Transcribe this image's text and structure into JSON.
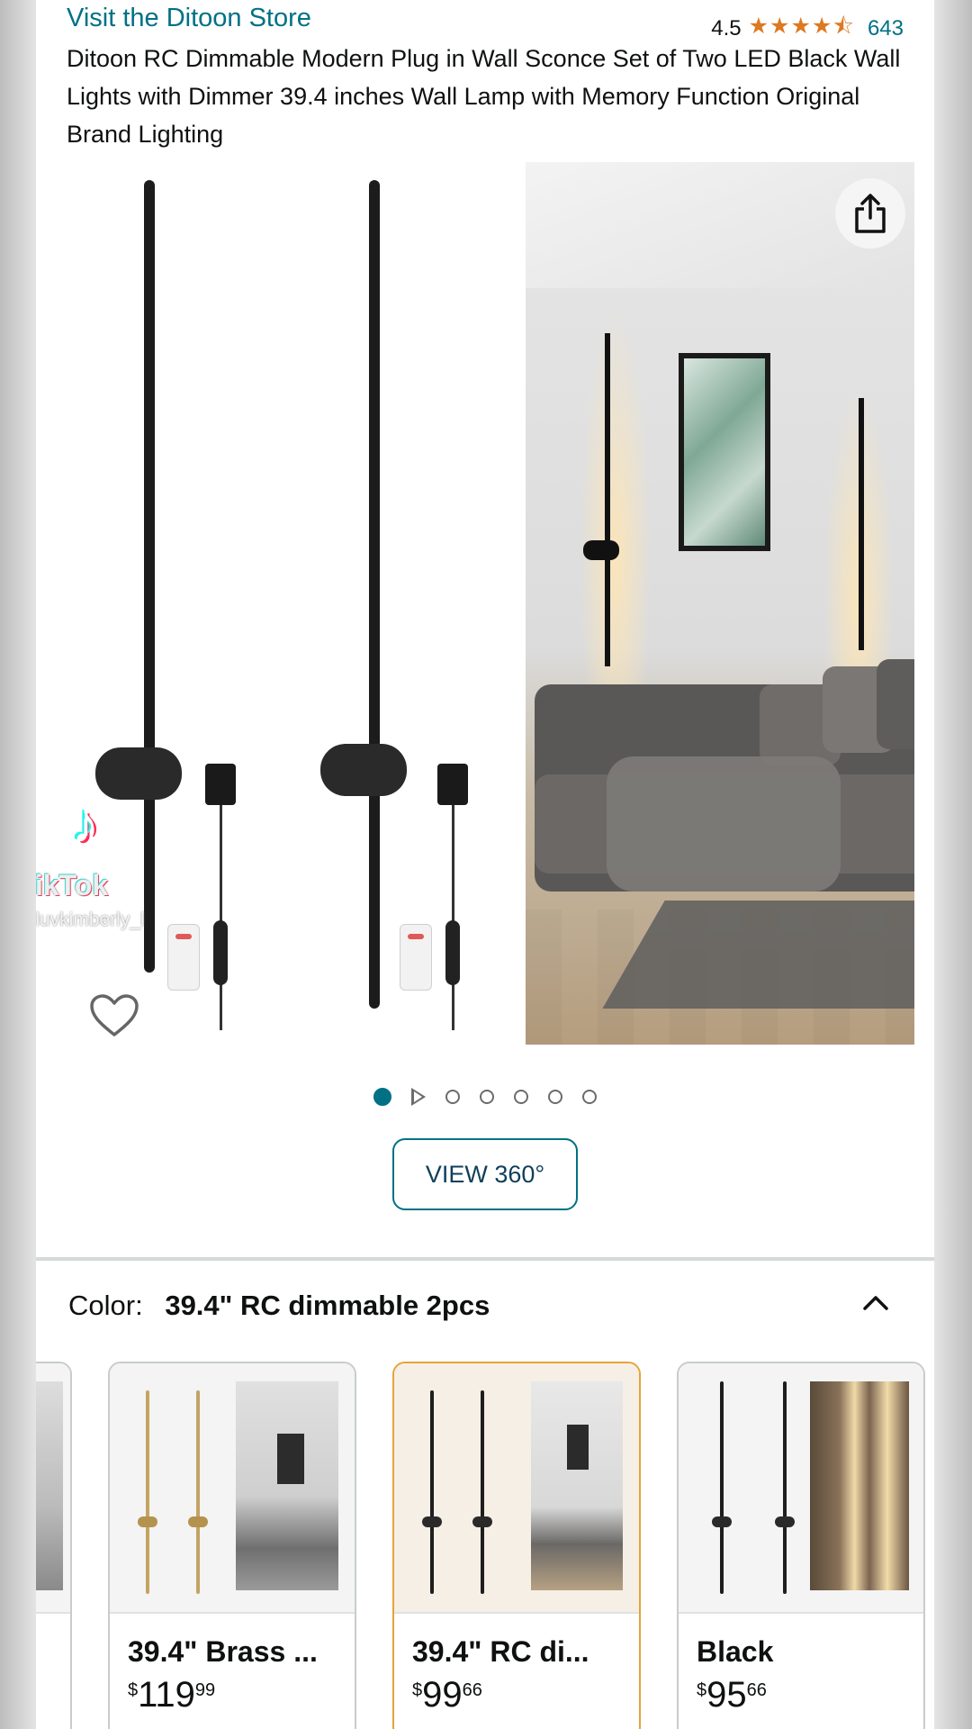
{
  "header": {
    "store_link": "Visit the Ditoon Store",
    "rating_value": "4.5",
    "stars": "★★★★⯪",
    "rating_count": "643",
    "product_title": "Ditoon RC Dimmable Modern Plug in Wall Sconce Set of Two LED Black Wall Lights with Dimmer 39.4 inches Wall Lamp with Memory Function Original Brand Lighting"
  },
  "gallery": {
    "share_icon": "share-icon",
    "favorite_icon": "heart-icon",
    "dot_count": 7,
    "active_dot": 0,
    "view360_label": "VIEW 360°"
  },
  "watermark": {
    "app": "TikTok",
    "user": "@luvkimberly_l"
  },
  "color_selector": {
    "label": "Color:",
    "selected_value": "39.4\" RC dimmable 2pcs",
    "collapse_icon": "chevron-up-icon",
    "options": [
      {
        "name": "",
        "currency": "",
        "whole": "",
        "fraction": ""
      },
      {
        "name": "39.4\" Brass ...",
        "currency": "$",
        "whole": "119",
        "fraction": "99"
      },
      {
        "name": "39.4\" RC di...",
        "currency": "$",
        "whole": "99",
        "fraction": "66"
      },
      {
        "name": "Black",
        "currency": "$",
        "whole": "95",
        "fraction": "66"
      }
    ]
  },
  "colors": {
    "link": "#007185",
    "star": "#de7921",
    "selected_border": "#e7a33b"
  }
}
